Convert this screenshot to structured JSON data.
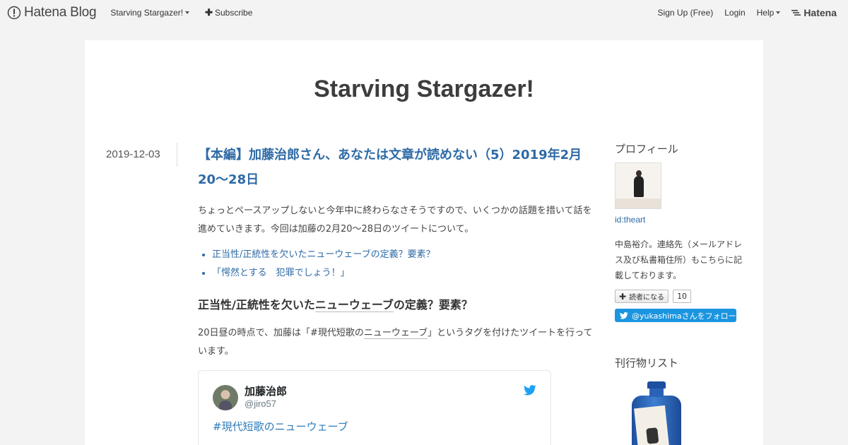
{
  "globalheader": {
    "logo_text": "Hatena Blog",
    "blog_menu_label": "Starving Stargazer!",
    "subscribe_label": "Subscribe",
    "signup_label": "Sign Up (Free)",
    "login_label": "Login",
    "help_label": "Help",
    "brand_label": "Hatena"
  },
  "blog": {
    "title": "Starving Stargazer!"
  },
  "entry": {
    "date": "2019-12-03",
    "title": "【本編】加藤治郎さん、あなたは文章が読めない（5）2019年2月20～28日",
    "intro": "ちょっとペースアップしないと今年中に終わらなさそうですので、いくつかの話題を措いて話を進めていきます。今回は加藤の2月20～28日のツイートについて。",
    "toc": [
      {
        "label": "正当性/正統性を欠いたニューウェーブの定義？要素？"
      },
      {
        "label": "「愕然とする　犯罪でしょう！」"
      }
    ],
    "section_heading_pre": "正当性/正統性を欠いた",
    "section_heading_link": "ニューウェーブ",
    "section_heading_post": "の定義？要素？",
    "para_pre": "20日昼の時点で、加藤は「#現代短歌の",
    "para_link": "ニューウェーブ",
    "para_post": "」というタグを付けたツイートを行っています。",
    "tweet": {
      "name": "加藤治郎",
      "handle": "@jiro57",
      "hashtag": "#現代短歌のニューウェーブ"
    }
  },
  "sidebar": {
    "profile_heading": "プロフィール",
    "profile_id": "id:theart",
    "profile_desc": "中島裕介。連絡先（メールアドレス及び私書箱住所）もこちらに記載しております。",
    "reader_button_label": "読者になる",
    "reader_count": "10",
    "follow_label": "@yukashimaさんをフォロー",
    "publications_heading": "刊行物リスト"
  },
  "colors": {
    "link": "#2e6aa6",
    "twitter_blue": "#1b95e0",
    "background": "#f3f3f3"
  }
}
